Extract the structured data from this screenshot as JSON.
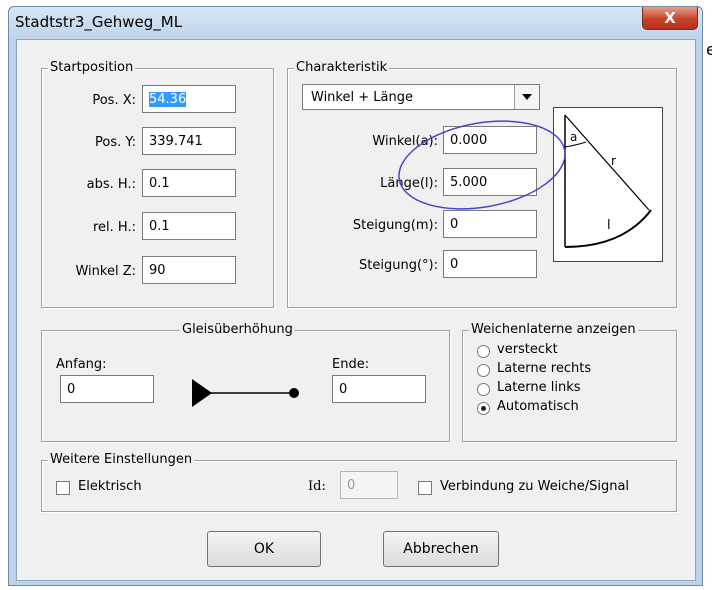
{
  "window": {
    "title": "Stadtstr3_Gehweg_ML",
    "close_label": "X"
  },
  "background_fragment": "e",
  "startposition": {
    "legend": "Startposition",
    "fields": [
      {
        "label": "Pos. X:",
        "value": "54.36",
        "selected": true
      },
      {
        "label": "Pos. Y:",
        "value": "339.741"
      },
      {
        "label": "abs. H.:",
        "value": "0.1"
      },
      {
        "label": "rel. H.:",
        "value": "0.1"
      },
      {
        "label": "Winkel Z:",
        "value": "90"
      }
    ]
  },
  "charakteristik": {
    "legend": "Charakteristik",
    "mode_selected": "Winkel + Länge",
    "fields": [
      {
        "label": "Winkel(a):",
        "value": "0.000"
      },
      {
        "label": "Länge(l):",
        "value": "5.000"
      },
      {
        "label": "Steigung(m):",
        "value": "0"
      },
      {
        "label": "Steigung(°):",
        "value": "0"
      }
    ],
    "diagram_labels": {
      "angle": "a",
      "radius": "r",
      "length": "l"
    }
  },
  "gleisueberhoehung": {
    "legend": "Gleisüberhöhung",
    "start_label": "Anfang:",
    "start_value": "0",
    "end_label": "Ende:",
    "end_value": "0"
  },
  "weichenlaterne": {
    "legend": "Weichenlaterne anzeigen",
    "options": [
      {
        "label": "versteckt",
        "checked": false
      },
      {
        "label": "Laterne rechts",
        "checked": false
      },
      {
        "label": "Laterne links",
        "checked": false
      },
      {
        "label": "Automatisch",
        "checked": true
      }
    ]
  },
  "weitere": {
    "legend": "Weitere Einstellungen",
    "elektrisch_label": "Elektrisch",
    "id_label": "Id:",
    "id_value": "0",
    "verbindung_label": "Verbindung zu Weiche/Signal"
  },
  "buttons": {
    "ok": "OK",
    "cancel": "Abbrechen"
  },
  "annotation_color": "#3b3bd6"
}
